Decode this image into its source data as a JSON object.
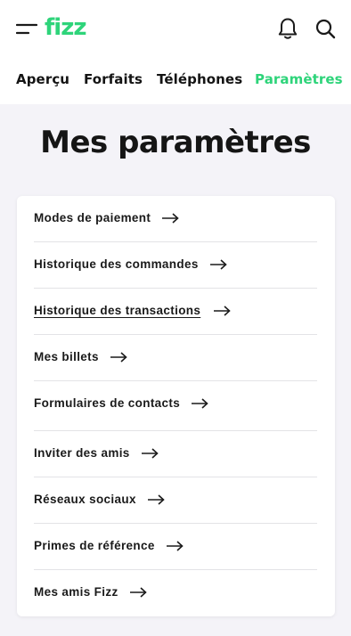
{
  "header": {
    "logo_text": "fizz",
    "brand_color": "#2ed47a",
    "icons": [
      "menu-icon",
      "bell-icon",
      "search-icon"
    ]
  },
  "tabs": [
    {
      "label": "Aperçu",
      "active": false
    },
    {
      "label": "Forfaits",
      "active": false
    },
    {
      "label": "Téléphones",
      "active": false
    },
    {
      "label": "Paramètres",
      "active": true
    }
  ],
  "page": {
    "title": "Mes paramètres"
  },
  "settings": {
    "items": [
      {
        "label": "Modes de paiement",
        "icon": "arrow-right-icon"
      },
      {
        "label": "Historique des commandes",
        "icon": "arrow-right-icon"
      },
      {
        "label": "Historique des transactions",
        "icon": "arrow-right-icon",
        "underlined": true
      },
      {
        "label": "Mes billets",
        "icon": "arrow-right-icon"
      },
      {
        "label": "Formulaires de contacts",
        "icon": "arrow-right-icon"
      },
      {
        "label": "Inviter des amis",
        "icon": "arrow-right-icon"
      },
      {
        "label": "Réseaux sociaux",
        "icon": "arrow-right-icon"
      },
      {
        "label": "Primes de référence",
        "icon": "arrow-right-icon"
      },
      {
        "label": "Mes amis Fizz",
        "icon": "arrow-right-icon"
      }
    ]
  }
}
